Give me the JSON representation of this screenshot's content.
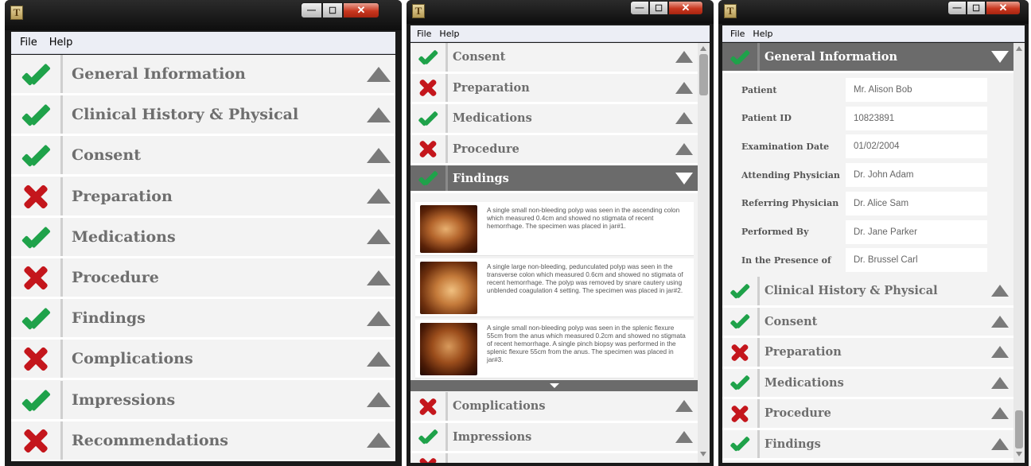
{
  "app_icon_letter": "T",
  "window_buttons": {
    "minimize": "—",
    "maximize": "☐",
    "close": "✕"
  },
  "menu": {
    "file": "File",
    "help": "Help"
  },
  "left_window": {
    "sections": [
      {
        "label": "General Information",
        "status": "check"
      },
      {
        "label": "Clinical History & Physical",
        "status": "check"
      },
      {
        "label": "Consent",
        "status": "check"
      },
      {
        "label": "Preparation",
        "status": "cross"
      },
      {
        "label": "Medications",
        "status": "check"
      },
      {
        "label": "Procedure",
        "status": "cross"
      },
      {
        "label": "Findings",
        "status": "check"
      },
      {
        "label": "Complications",
        "status": "cross"
      },
      {
        "label": "Impressions",
        "status": "check"
      },
      {
        "label": "Recommendations",
        "status": "cross"
      }
    ]
  },
  "middle_window": {
    "sections_top": [
      {
        "label": "Consent",
        "status": "check"
      },
      {
        "label": "Preparation",
        "status": "cross"
      },
      {
        "label": "Medications",
        "status": "check"
      },
      {
        "label": "Procedure",
        "status": "cross"
      }
    ],
    "active_section": {
      "label": "Findings",
      "status": "check"
    },
    "findings": [
      {
        "text": "A single small non-bleeding polyp was seen in the ascending colon which measured 0.4cm and showed no stigmata of recent hemorrhage. The specimen was placed in jar#1."
      },
      {
        "text": "A single large non-bleeding, pedunculated polyp was seen in the transverse colon which measured 0.6cm and showed no stigmata of recent hemorrhage. The polyp was removed by snare cautery using unblended coagulation 4 setting. The specimen was placed in jar#2."
      },
      {
        "text": "A single small non-bleeding polyp was seen in the splenic flexure 55cm from the anus which measured 0.2cm and showed no stigmata of recent hemorrhage. A single pinch biopsy was performed in the splenic flexure 55cm from the anus. The specimen was placed in jar#3."
      }
    ],
    "sections_bottom": [
      {
        "label": "Complications",
        "status": "cross"
      },
      {
        "label": "Impressions",
        "status": "check"
      }
    ]
  },
  "right_window": {
    "active_section": {
      "label": "General Information",
      "status": "check"
    },
    "fields": [
      {
        "label": "Patient",
        "value": "Mr. Alison Bob"
      },
      {
        "label": "Patient ID",
        "value": "10823891"
      },
      {
        "label": "Examination Date",
        "value": "01/02/2004"
      },
      {
        "label": "Attending Physician",
        "value": "Dr. John Adam"
      },
      {
        "label": "Referring Physician",
        "value": "Dr. Alice Sam"
      },
      {
        "label": "Performed By",
        "value": "Dr. Jane Parker"
      },
      {
        "label": "In the Presence of",
        "value": "Dr. Brussel Carl"
      }
    ],
    "sections": [
      {
        "label": "Clinical History & Physical",
        "status": "check"
      },
      {
        "label": "Consent",
        "status": "check"
      },
      {
        "label": "Preparation",
        "status": "cross"
      },
      {
        "label": "Medications",
        "status": "check"
      },
      {
        "label": "Procedure",
        "status": "cross"
      },
      {
        "label": "Findings",
        "status": "check"
      }
    ]
  },
  "colors": {
    "check": "#1fa24a",
    "cross": "#c4161c",
    "active_header": "#6b6b6b"
  }
}
